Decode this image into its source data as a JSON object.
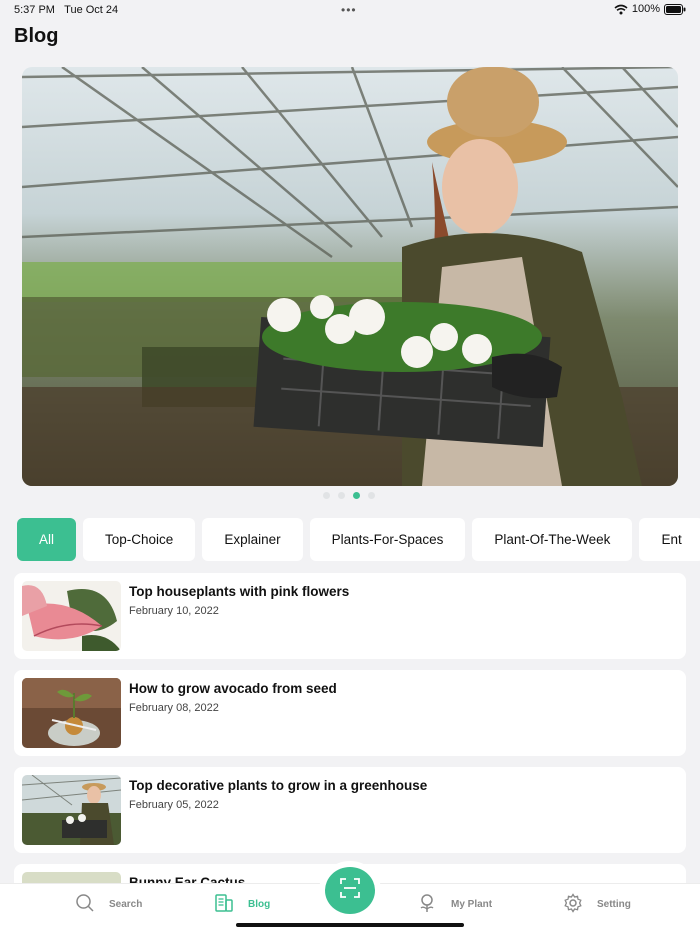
{
  "status_bar": {
    "time": "5:37 PM",
    "date": "Tue Oct 24",
    "battery": "100%"
  },
  "page": {
    "title": "Blog"
  },
  "carousel": {
    "slide_count": 4,
    "active_index": 2
  },
  "categories": [
    "All",
    "Top-Choice",
    "Explainer",
    "Plants-For-Spaces",
    "Plant-Of-The-Week",
    "Ent"
  ],
  "active_category": "All",
  "posts": [
    {
      "title": "Top houseplants with pink flowers",
      "date": "February 10, 2022"
    },
    {
      "title": "How to grow avocado from seed",
      "date": "February 08, 2022"
    },
    {
      "title": "Top decorative plants to grow in a greenhouse",
      "date": "February 05, 2022"
    },
    {
      "title": "Bunny Ear Cactus",
      "date": ""
    }
  ],
  "tab_bar": {
    "search": "Search",
    "blog": "Blog",
    "my_plant": "My Plant",
    "setting": "Setting"
  },
  "colors": {
    "accent": "#3cbf91",
    "background": "#f2f2f4",
    "card": "#ffffff"
  }
}
